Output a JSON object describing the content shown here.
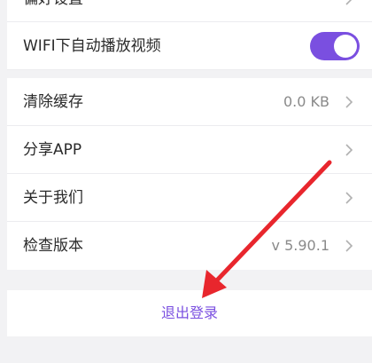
{
  "settings": {
    "privacy_label": "偏好设置",
    "wifi_autoplay_label": "WIFI下自动播放视频",
    "wifi_autoplay_enabled": true,
    "clear_cache_label": "清除缓存",
    "clear_cache_value": "0.0 KB",
    "share_app_label": "分享APP",
    "about_us_label": "关于我们",
    "check_version_label": "检查版本",
    "check_version_value": "v 5.90.1",
    "logout_label": "退出登录"
  },
  "colors": {
    "accent": "#7a4fe0",
    "annotation_arrow": "#e8262d"
  }
}
